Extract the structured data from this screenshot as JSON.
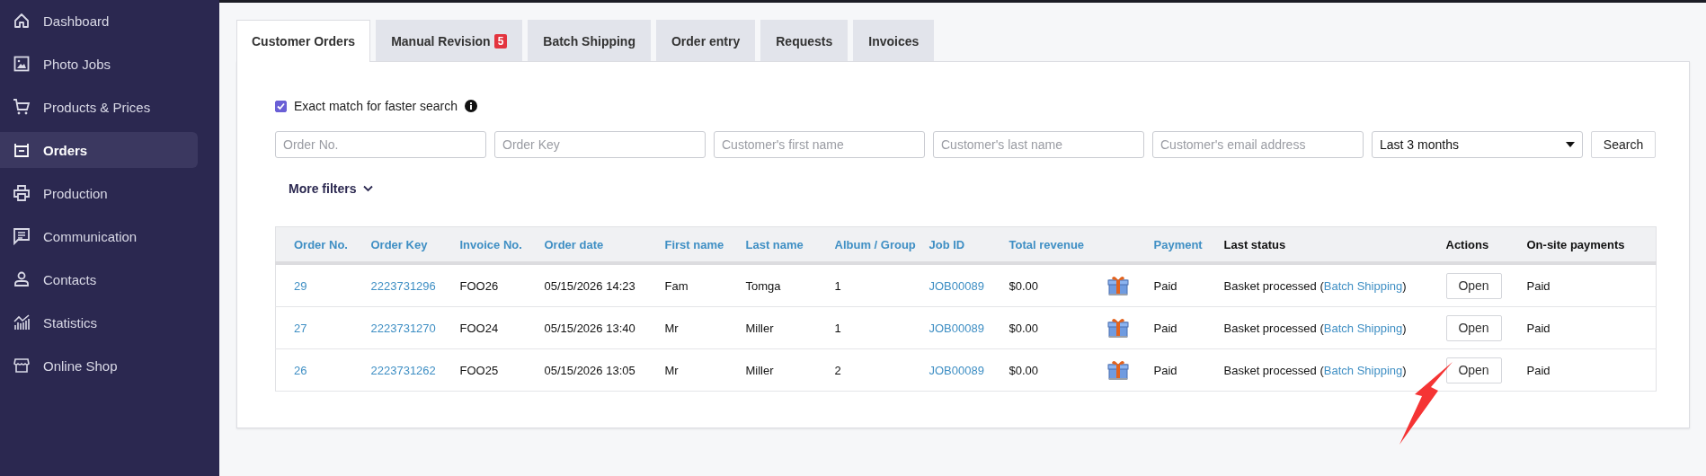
{
  "sidebar": {
    "items": [
      {
        "label": "Dashboard",
        "selected": false
      },
      {
        "label": "Photo Jobs",
        "selected": false
      },
      {
        "label": "Products & Prices",
        "selected": false
      },
      {
        "label": "Orders",
        "selected": true
      },
      {
        "label": "Production",
        "selected": false
      },
      {
        "label": "Communication",
        "selected": false
      },
      {
        "label": "Contacts",
        "selected": false
      },
      {
        "label": "Statistics",
        "selected": false
      },
      {
        "label": "Online Shop",
        "selected": false
      }
    ]
  },
  "tabs": [
    {
      "label": "Customer Orders",
      "selected": true
    },
    {
      "label": "Manual Revision",
      "selected": false,
      "badge": "5"
    },
    {
      "label": "Batch Shipping",
      "selected": false
    },
    {
      "label": "Order entry",
      "selected": false
    },
    {
      "label": "Requests",
      "selected": false
    },
    {
      "label": "Invoices",
      "selected": false
    }
  ],
  "filters": {
    "exact_match": {
      "label": "Exact match for faster search",
      "checked": true
    },
    "fields": [
      {
        "placeholder": "Order No."
      },
      {
        "placeholder": "Order Key"
      },
      {
        "placeholder": "Customer's first name"
      },
      {
        "placeholder": "Customer's last name"
      },
      {
        "placeholder": "Customer's email address"
      }
    ],
    "period": {
      "value": "Last 3 months"
    },
    "search_button": "Search",
    "more_filters": "More filters"
  },
  "table": {
    "columns": [
      {
        "label": "Order No.",
        "sortable": true
      },
      {
        "label": "Order Key",
        "sortable": true
      },
      {
        "label": "Invoice No.",
        "sortable": true
      },
      {
        "label": "Order date",
        "sortable": true
      },
      {
        "label": "First name",
        "sortable": true
      },
      {
        "label": "Last name",
        "sortable": true
      },
      {
        "label": "Album / Group",
        "sortable": true
      },
      {
        "label": "Job ID",
        "sortable": true
      },
      {
        "label": "Total revenue",
        "sortable": true
      },
      {
        "label": "Payment",
        "sortable": true
      },
      {
        "label": "Last status",
        "sortable": false
      },
      {
        "label": "Actions",
        "sortable": false
      },
      {
        "label": "On-site payments",
        "sortable": false
      }
    ],
    "rows": [
      {
        "order_no": "29",
        "order_key": "2223731296",
        "invoice_no": "FOO26",
        "order_date": "05/15/2026 14:23",
        "first_name": "Fam",
        "last_name": "Tomga",
        "album_group": "1",
        "job_id": "JOB00089",
        "total_revenue": "$0.00",
        "payment": "Paid",
        "last_status": {
          "text": "Basket processed (",
          "link": "Batch Shipping",
          "after": ")"
        },
        "action": "Open",
        "onsite_payment": "Paid"
      },
      {
        "order_no": "27",
        "order_key": "2223731270",
        "invoice_no": "FOO24",
        "order_date": "05/15/2026 13:40",
        "first_name": "Mr",
        "last_name": "Miller",
        "album_group": "1",
        "job_id": "JOB00089",
        "total_revenue": "$0.00",
        "payment": "Paid",
        "last_status": {
          "text": "Basket processed (",
          "link": "Batch Shipping",
          "after": ")"
        },
        "action": "Open",
        "onsite_payment": "Paid"
      },
      {
        "order_no": "26",
        "order_key": "2223731262",
        "invoice_no": "FOO25",
        "order_date": "05/15/2026 13:05",
        "first_name": "Mr",
        "last_name": "Miller",
        "album_group": "2",
        "job_id": "JOB00089",
        "total_revenue": "$0.00",
        "payment": "Paid",
        "last_status": {
          "text": "Basket processed (",
          "link": "Batch Shipping",
          "after": ")"
        },
        "action": "Open",
        "onsite_payment": "Paid"
      }
    ]
  }
}
